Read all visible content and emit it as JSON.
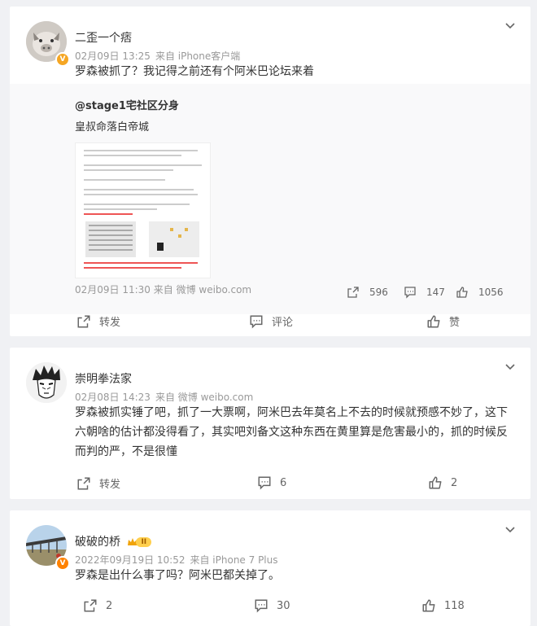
{
  "posts": [
    {
      "author": "二歪一个痞",
      "date": "02月09日 13:25",
      "source": "来自 iPhone客户端",
      "text": "罗森被抓了？我记得之前还有个阿米巴论坛来着",
      "repost": {
        "author": "@stage1宅社区分身",
        "text": "皇叔命落白帝城",
        "meta": "02月09日 11:30 来自 微博 weibo.com",
        "reposts": "596",
        "comments": "147",
        "likes": "1056"
      },
      "actions": {
        "repost": "转发",
        "comment": "评论",
        "like": "赞"
      }
    },
    {
      "author": "崇明拳法家",
      "date": "02月08日 14:23",
      "source": "来自 微博 weibo.com",
      "text": "罗森被抓实锤了吧，抓了一大票啊，阿米巴去年莫名上不去的时候就预感不妙了，这下六朝啥的估计都没得看了，其实吧刘备文这种东西在黄里算是危害最小的，抓的时候反而判的严，不是很懂",
      "actions": {
        "repost": "转发",
        "comment": "6",
        "like": "2"
      }
    },
    {
      "author": "破破的桥",
      "level": "II",
      "date": "2022年09月19日 10:52",
      "source": "来自 iPhone 7 Plus",
      "text": "罗森是出什么事了吗？阿米巴都关掉了。",
      "actions": {
        "repost": "2",
        "comment": "30",
        "like": "118"
      }
    }
  ],
  "colors": {
    "bg": "#f0f1f4",
    "card": "#ffffff",
    "meta": "#999999",
    "badge": "#f5a623"
  }
}
